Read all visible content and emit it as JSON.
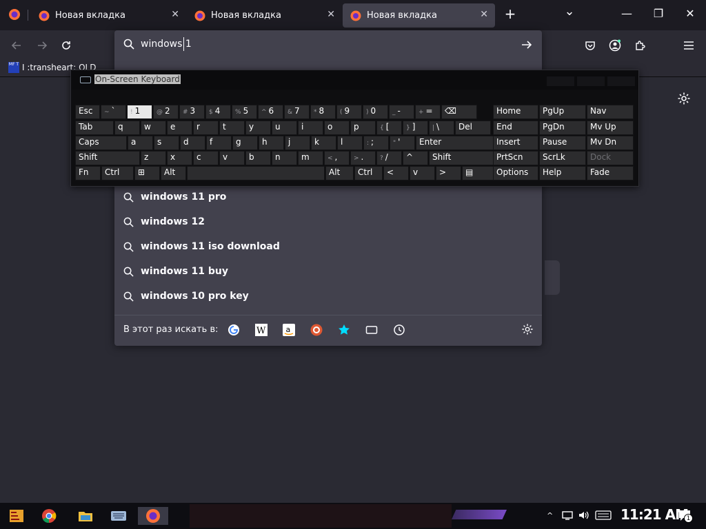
{
  "browser": {
    "tabs": [
      {
        "title": "Новая вкладка",
        "active": false
      },
      {
        "title": "Новая вкладка",
        "active": false
      },
      {
        "title": "Новая вкладка",
        "active": true
      }
    ],
    "new_tab_glyph": "+",
    "list_tabs_glyph": "⌄",
    "window_controls": {
      "minimize": "—",
      "maximize": "❐",
      "close": "✕"
    },
    "bookmark": {
      "label": "I :transheart: OLD",
      "icon_text": "MF T"
    }
  },
  "urlbar": {
    "value": "windows 1",
    "suggestions": [
      "windows 11 pro",
      "windows 12",
      "windows 11 iso download",
      "windows 11 buy",
      "windows 10 pro key"
    ],
    "search_with_label": "В этот раз искать в:",
    "engines": [
      "google-icon",
      "wikipedia-icon",
      "amazon-icon",
      "duckduckgo-icon",
      "bookmarks-star-icon",
      "tabs-icon",
      "history-icon"
    ]
  },
  "osk": {
    "title": "On-Screen Keyboard",
    "rows": [
      [
        [
          "Esc",
          ""
        ],
        [
          "`",
          "~"
        ],
        [
          "1",
          "!"
        ],
        [
          "2",
          "@"
        ],
        [
          "3",
          "#"
        ],
        [
          "4",
          "$"
        ],
        [
          "5",
          "%"
        ],
        [
          "6",
          "^"
        ],
        [
          "7",
          "&"
        ],
        [
          "8",
          "*"
        ],
        [
          "9",
          "("
        ],
        [
          "0",
          ")"
        ],
        [
          "-",
          "_"
        ],
        [
          "=",
          "+"
        ],
        [
          "⌫",
          ""
        ]
      ],
      [
        [
          "Tab",
          ""
        ],
        [
          "q",
          ""
        ],
        [
          "w",
          ""
        ],
        [
          "e",
          ""
        ],
        [
          "r",
          ""
        ],
        [
          "t",
          ""
        ],
        [
          "y",
          ""
        ],
        [
          "u",
          ""
        ],
        [
          "i",
          ""
        ],
        [
          "o",
          ""
        ],
        [
          "p",
          ""
        ],
        [
          "[",
          "{"
        ],
        [
          "]",
          "}"
        ],
        [
          "\\",
          "|"
        ],
        [
          "Del",
          ""
        ]
      ],
      [
        [
          "Caps",
          ""
        ],
        [
          "a",
          ""
        ],
        [
          "s",
          ""
        ],
        [
          "d",
          ""
        ],
        [
          "f",
          ""
        ],
        [
          "g",
          ""
        ],
        [
          "h",
          ""
        ],
        [
          "j",
          ""
        ],
        [
          "k",
          ""
        ],
        [
          "l",
          ""
        ],
        [
          ";",
          ":"
        ],
        [
          "'",
          "\""
        ],
        [
          "Enter",
          ""
        ]
      ],
      [
        [
          "Shift",
          ""
        ],
        [
          "z",
          ""
        ],
        [
          "x",
          ""
        ],
        [
          "c",
          ""
        ],
        [
          "v",
          ""
        ],
        [
          "b",
          ""
        ],
        [
          "n",
          ""
        ],
        [
          "m",
          ""
        ],
        [
          ",",
          "<"
        ],
        [
          ".",
          ">"
        ],
        [
          "/",
          "?"
        ],
        [
          "^",
          ""
        ],
        [
          "Shift",
          ""
        ]
      ],
      [
        [
          "Fn",
          ""
        ],
        [
          "Ctrl",
          ""
        ],
        [
          "⊞",
          ""
        ],
        [
          "Alt",
          ""
        ],
        [
          "",
          ""
        ],
        [
          "Alt",
          ""
        ],
        [
          "Ctrl",
          ""
        ],
        [
          "<",
          ""
        ],
        [
          "v",
          ""
        ],
        [
          ">",
          ""
        ],
        [
          "▤",
          ""
        ]
      ]
    ],
    "nav_keys": [
      [
        "Home",
        "PgUp",
        "Nav"
      ],
      [
        "End",
        "PgDn",
        "Mv Up"
      ],
      [
        "Insert",
        "Pause",
        "Mv Dn"
      ],
      [
        "PrtScn",
        "ScrLk",
        "Dock"
      ],
      [
        "Options",
        "Help",
        "Fade"
      ]
    ]
  },
  "taskbar": {
    "clock": "11:21 AM",
    "notif_count": "1"
  },
  "colors": {
    "accent": "#7a4bc7",
    "panel": "#42414d",
    "bg": "#2a2a33"
  }
}
